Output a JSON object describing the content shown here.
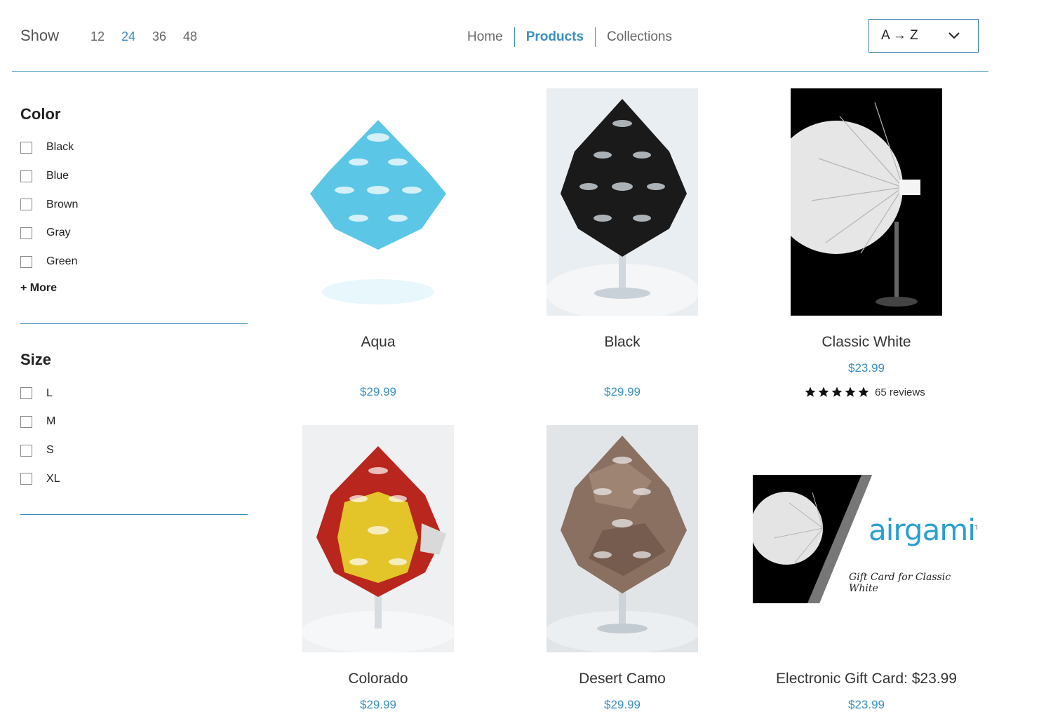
{
  "toolbar": {
    "show_label": "Show",
    "per_page": [
      "12",
      "24",
      "36",
      "48"
    ],
    "per_page_active": "24",
    "sort_value": "A → Z"
  },
  "nav": {
    "home": "Home",
    "products": "Products",
    "collections": "Collections"
  },
  "filters": {
    "color": {
      "title": "Color",
      "options": [
        "Black",
        "Blue",
        "Brown",
        "Gray",
        "Green"
      ],
      "more": "+ More"
    },
    "size": {
      "title": "Size",
      "options": [
        "L",
        "M",
        "S",
        "XL"
      ]
    }
  },
  "products": [
    {
      "name": "Aqua",
      "price": "$29.99"
    },
    {
      "name": "Black",
      "price": "$29.99"
    },
    {
      "name": "Classic White",
      "price": "$23.99",
      "rating": 5,
      "reviews": "65 reviews"
    },
    {
      "name": "Colorado",
      "price": "$29.99"
    },
    {
      "name": "Desert Camo",
      "price": "$29.99"
    },
    {
      "name": "Electronic Gift Card: $23.99",
      "price": "$23.99",
      "logo_text": "airgami",
      "logo_tm": "TM",
      "card_caption": "Gift Card for Classic White"
    }
  ],
  "colors": {
    "accent": "#3a8fc0",
    "aqua": "#5cc6e6",
    "black_mask": "#1a1a1a",
    "red": "#b8261d",
    "yellow": "#e3c52a",
    "camo": "#8a7060"
  }
}
